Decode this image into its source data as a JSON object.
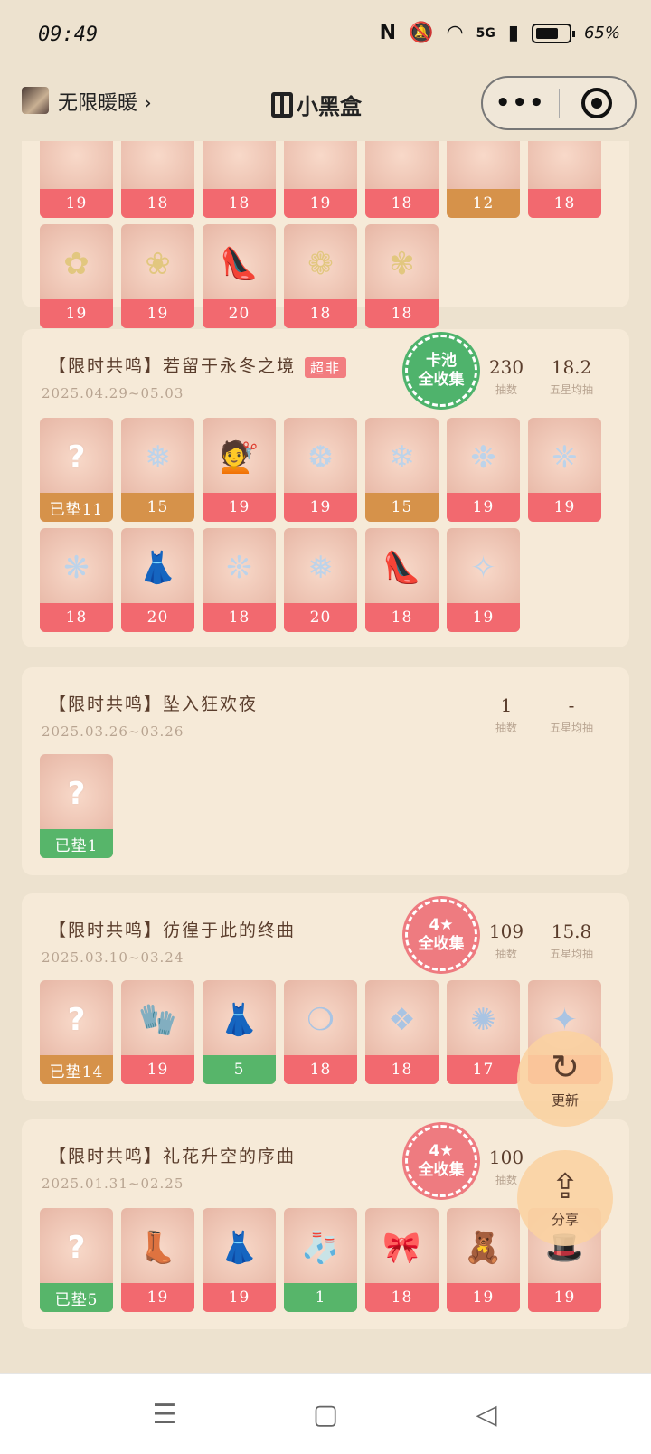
{
  "status": {
    "time": "09:49",
    "network": "5G",
    "battery": "65%"
  },
  "nav": {
    "user": "无限暖暖 ›",
    "app_name": "小黑盒",
    "more_icon": "•••"
  },
  "top_partial": {
    "row1": [
      {
        "n": "19",
        "c": "red"
      },
      {
        "n": "18",
        "c": "red"
      },
      {
        "n": "18",
        "c": "red"
      },
      {
        "n": "19",
        "c": "red"
      },
      {
        "n": "18",
        "c": "red"
      },
      {
        "n": "12",
        "c": "orange"
      },
      {
        "n": "18",
        "c": "red"
      }
    ],
    "row2": [
      {
        "n": "19",
        "c": "red",
        "art": "✿"
      },
      {
        "n": "19",
        "c": "red",
        "art": "❀"
      },
      {
        "n": "20",
        "c": "red",
        "art": "👠"
      },
      {
        "n": "18",
        "c": "red",
        "art": "❁"
      },
      {
        "n": "18",
        "c": "red",
        "art": "✾"
      }
    ]
  },
  "cards": [
    {
      "title": "【限时共鸣】若留于永冬之境",
      "tag": "超非",
      "date": "2025.04.29~05.03",
      "badge": "卡池\n全收集",
      "pulls": "230",
      "pulls_label": "抽数",
      "avg": "18.2",
      "avg_label": "五星均抽",
      "items": [
        {
          "n": "已垫11",
          "c": "orange",
          "q": true
        },
        {
          "n": "15",
          "c": "orange",
          "art": "❅"
        },
        {
          "n": "19",
          "c": "red",
          "art": "💇"
        },
        {
          "n": "19",
          "c": "red",
          "art": "❆"
        },
        {
          "n": "15",
          "c": "orange",
          "art": "❄"
        },
        {
          "n": "19",
          "c": "red",
          "art": "❉"
        },
        {
          "n": "19",
          "c": "red",
          "art": "❈"
        },
        {
          "n": "18",
          "c": "red",
          "art": "❋"
        },
        {
          "n": "20",
          "c": "red",
          "art": "👗"
        },
        {
          "n": "18",
          "c": "red",
          "art": "❊"
        },
        {
          "n": "20",
          "c": "red",
          "art": "❅"
        },
        {
          "n": "18",
          "c": "red",
          "art": "👠"
        },
        {
          "n": "19",
          "c": "red",
          "art": "✧"
        }
      ]
    },
    {
      "title": "【限时共鸣】坠入狂欢夜",
      "date": "2025.03.26~03.26",
      "pulls": "1",
      "pulls_label": "抽数",
      "avg": "-",
      "avg_label": "五星均抽",
      "items": [
        {
          "n": "已垫1",
          "c": "green",
          "q": true
        }
      ]
    },
    {
      "title": "【限时共鸣】彷徨于此的终曲",
      "date": "2025.03.10~03.24",
      "badge": "4★\n全收集",
      "pulls": "109",
      "pulls_label": "抽数",
      "avg": "15.8",
      "avg_label": "五星均抽",
      "items": [
        {
          "n": "已垫14",
          "c": "orange",
          "q": true
        },
        {
          "n": "19",
          "c": "red",
          "art": "🧤"
        },
        {
          "n": "5",
          "c": "green",
          "art": "👗"
        },
        {
          "n": "18",
          "c": "red",
          "art": "❍"
        },
        {
          "n": "18",
          "c": "red",
          "art": "❖"
        },
        {
          "n": "17",
          "c": "red",
          "art": "✺"
        },
        {
          "n": "",
          "c": "red",
          "art": "✦"
        }
      ]
    },
    {
      "title": "【限时共鸣】礼花升空的序曲",
      "date": "2025.01.31~02.25",
      "badge": "4★\n全收集",
      "pulls": "100",
      "pulls_label": "抽数",
      "avg": "",
      "avg_label": "",
      "items": [
        {
          "n": "已垫5",
          "c": "green",
          "q": true
        },
        {
          "n": "19",
          "c": "red",
          "art": "👢"
        },
        {
          "n": "19",
          "c": "red",
          "art": "👗"
        },
        {
          "n": "1",
          "c": "green",
          "art": "🧦"
        },
        {
          "n": "18",
          "c": "red",
          "art": "🎀"
        },
        {
          "n": "19",
          "c": "red",
          "art": "🧸"
        },
        {
          "n": "19",
          "c": "red",
          "art": "🎩"
        }
      ]
    }
  ],
  "fab_refresh": {
    "icon": "↻",
    "label": "更新"
  },
  "fab_share": {
    "icon": "⇪",
    "label": "分享"
  },
  "bottom_nav": {
    "menu": "☰",
    "home": "▢",
    "back": "◁"
  }
}
